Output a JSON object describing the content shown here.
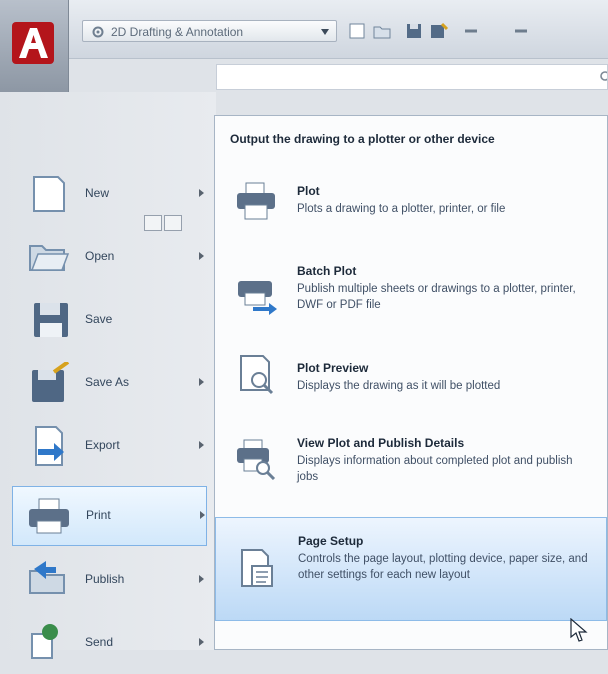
{
  "app": {
    "workspace": "2D Drafting & Annotation"
  },
  "colors": {
    "accent": "#c6191f",
    "selected_bg": "#d2e8fb",
    "selected_border": "#7fb2e6"
  },
  "quick_access": [
    {
      "name": "new-icon"
    },
    {
      "name": "open-icon"
    },
    {
      "name": "save-icon"
    },
    {
      "name": "save-as-icon"
    },
    {
      "name": "undo-icon"
    },
    {
      "name": "redo-icon"
    }
  ],
  "menu": {
    "items": [
      {
        "label": "New",
        "icon": "new-document-icon",
        "has_submenu": true
      },
      {
        "label": "Open",
        "icon": "open-folder-icon",
        "has_submenu": true
      },
      {
        "label": "Save",
        "icon": "floppy-disk-icon",
        "has_submenu": false
      },
      {
        "label": "Save As",
        "icon": "save-as-icon",
        "has_submenu": true
      },
      {
        "label": "Export",
        "icon": "export-icon",
        "has_submenu": true
      },
      {
        "label": "Print",
        "icon": "printer-icon",
        "has_submenu": true,
        "selected": true
      },
      {
        "label": "Publish",
        "icon": "publish-icon",
        "has_submenu": true
      },
      {
        "label": "Send",
        "icon": "send-icon",
        "has_submenu": true
      }
    ]
  },
  "flyout": {
    "title": "Output the drawing to a plotter or other device",
    "items": [
      {
        "title": "Plot",
        "description": "Plots a drawing to a plotter, printer, or file",
        "icon": "plot-printer-icon"
      },
      {
        "title": "Batch Plot",
        "description": "Publish multiple sheets or drawings to a plotter, printer, DWF or PDF file",
        "icon": "batch-plot-icon"
      },
      {
        "title": "Plot Preview",
        "description": "Displays the drawing as it will be plotted",
        "icon": "plot-preview-icon"
      },
      {
        "title": "View Plot and Publish Details",
        "description": "Displays information about completed plot and publish jobs",
        "icon": "plot-details-icon"
      },
      {
        "title": "Page Setup",
        "description": "Controls the page layout, plotting device, paper size, and other settings for each new layout",
        "icon": "page-setup-icon",
        "selected": true
      }
    ]
  }
}
